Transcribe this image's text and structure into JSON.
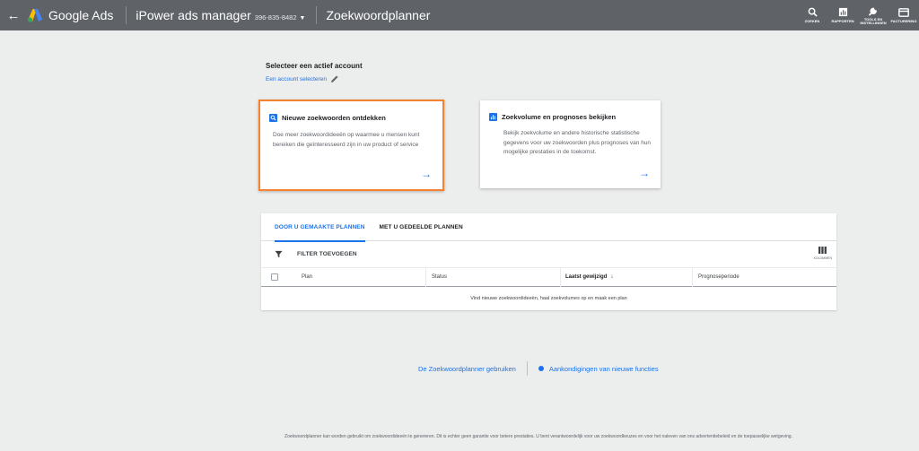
{
  "header": {
    "back_label": "←",
    "brand": "Google Ads",
    "account_name": "iPower ads manager",
    "account_id": "396-835-8482",
    "page_title": "Zoekwoordplanner",
    "actions": [
      {
        "label": "ZOEKEN",
        "icon": "search-icon"
      },
      {
        "label": "RAPPORTEN",
        "icon": "reports-icon"
      },
      {
        "label": "TOOLS EN INSTELLINGEN",
        "icon": "wrench-icon"
      },
      {
        "label": "FACTURERING",
        "icon": "billing-icon"
      }
    ]
  },
  "account_select": {
    "title": "Selecteer een actief account",
    "link": "Een account selecteren"
  },
  "cards": [
    {
      "title": "Nieuwe zoekwoorden ontdekken",
      "description": "Doe meer zoekwoordideeën op waarmee u mensen kunt bereiken die geïnteresseerd zijn in uw product of service",
      "icon": "search-icon",
      "arrow": "→"
    },
    {
      "title": "Zoekvolume en prognoses bekijken",
      "description": "Bekijk zoekvolume en andere historische statistische gegevens voor uw zoekwoorden plus prognoses van hun mogelijke prestaties in de toekomst.",
      "icon": "bar-chart-icon",
      "arrow": "→"
    }
  ],
  "plans": {
    "tabs": [
      {
        "label": "DOOR U GEMAAKTE PLANNEN",
        "active": true
      },
      {
        "label": "MET U GEDEELDE PLANNEN",
        "active": false
      }
    ],
    "filter_label": "FILTER TOEVOEGEN",
    "columns_label": "KOLOMMEN",
    "headers": {
      "plan": "Plan",
      "status": "Status",
      "modified": "Laatst gewijzigd",
      "forecast": "Prognoseperiode"
    },
    "empty_message": "Vind nieuwe zoekwoordideeën, haal zoekvolumes op en maak een plan"
  },
  "bottom_links": {
    "use_planner": "De Zoekwoordplanner gebruiken",
    "announcements": "Aankondigingen van nieuwe functies"
  },
  "footer": "Zoekwoordplanner kan worden gebruikt om zoekwoordideeën te genereren. Dit is echter geen garantie voor betere prestaties. U bent verantwoordelijk voor uw zoekwoordkeuzes en voor het naleven van ons advertentiebeleid en de toepasselijke wetgeving.",
  "colors": {
    "header_bg": "#5f6368",
    "accent": "#1a73e8",
    "highlight_border": "#f5822e",
    "page_bg": "#eceded"
  }
}
